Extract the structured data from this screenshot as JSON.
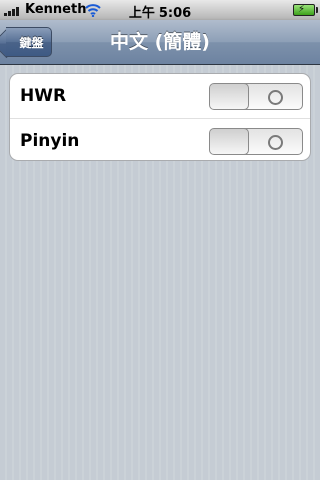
{
  "status_bar": {
    "carrier": "Kenneth",
    "time_prefix": "上午",
    "time": "5:06"
  },
  "nav": {
    "back_label": "鍵盤",
    "title": "中文 (簡體)"
  },
  "settings": [
    {
      "label": "HWR",
      "state": "off"
    },
    {
      "label": "Pinyin",
      "state": "off"
    }
  ]
}
